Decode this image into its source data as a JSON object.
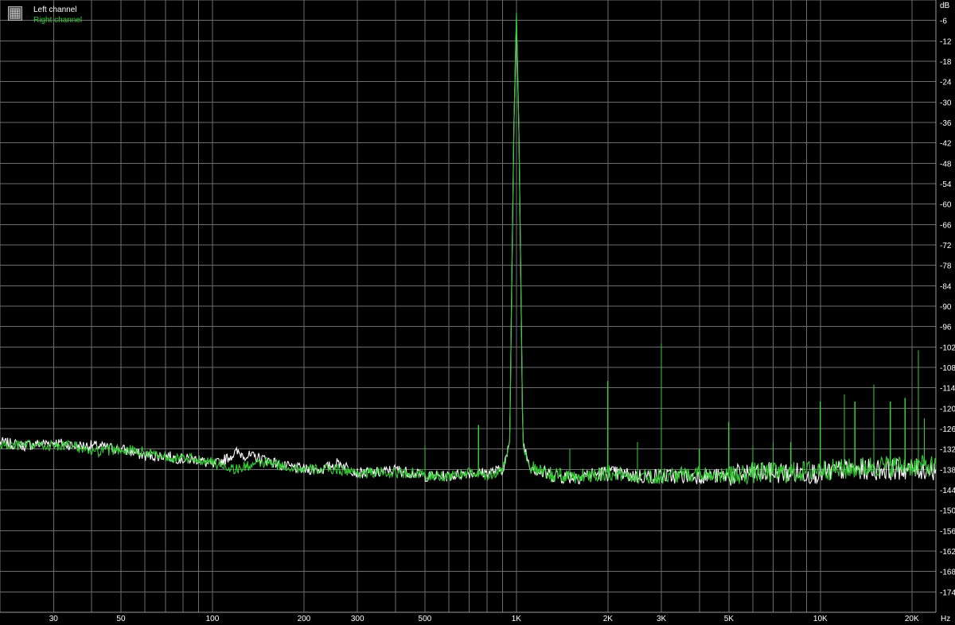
{
  "chart_data": {
    "type": "line",
    "title": "",
    "xlabel": "Hz",
    "ylabel": "dB",
    "x_scale": "log",
    "xlim": [
      20,
      24000
    ],
    "ylim": [
      -180,
      0
    ],
    "grid": true,
    "legend_placement": "top-left",
    "x_ticks": [
      {
        "value": 30,
        "label": "30"
      },
      {
        "value": 50,
        "label": "50"
      },
      {
        "value": 100,
        "label": "100"
      },
      {
        "value": 200,
        "label": "200"
      },
      {
        "value": 300,
        "label": "300"
      },
      {
        "value": 500,
        "label": "500"
      },
      {
        "value": 1000,
        "label": "1K"
      },
      {
        "value": 2000,
        "label": "2K"
      },
      {
        "value": 3000,
        "label": "3K"
      },
      {
        "value": 5000,
        "label": "5K"
      },
      {
        "value": 10000,
        "label": "10K"
      },
      {
        "value": 20000,
        "label": "20K"
      }
    ],
    "y_ticks": [
      -6,
      -12,
      -18,
      -24,
      -30,
      -36,
      -42,
      -48,
      -54,
      -60,
      -66,
      -72,
      -78,
      -84,
      -90,
      -96,
      -102,
      -108,
      -114,
      -120,
      -126,
      -132,
      -138,
      -144,
      -150,
      -156,
      -162,
      -168,
      -174
    ],
    "series": [
      {
        "name": "Left channel",
        "color": "#ffffff",
        "points": [
          [
            20,
            -130
          ],
          [
            24,
            -131
          ],
          [
            30,
            -130
          ],
          [
            35,
            -131
          ],
          [
            40,
            -131
          ],
          [
            50,
            -132
          ],
          [
            60,
            -134
          ],
          [
            70,
            -134
          ],
          [
            80,
            -135
          ],
          [
            90,
            -135
          ],
          [
            100,
            -137
          ],
          [
            110,
            -135
          ],
          [
            120,
            -133
          ],
          [
            130,
            -134
          ],
          [
            150,
            -135
          ],
          [
            170,
            -137
          ],
          [
            200,
            -138
          ],
          [
            230,
            -138
          ],
          [
            260,
            -136
          ],
          [
            300,
            -139
          ],
          [
            350,
            -139
          ],
          [
            400,
            -138
          ],
          [
            450,
            -139
          ],
          [
            500,
            -140
          ],
          [
            550,
            -140
          ],
          [
            600,
            -140
          ],
          [
            700,
            -139
          ],
          [
            800,
            -139
          ],
          [
            900,
            -138
          ],
          [
            950,
            -131
          ],
          [
            980,
            -40
          ],
          [
            1000,
            -5
          ],
          [
            1020,
            -40
          ],
          [
            1050,
            -130
          ],
          [
            1100,
            -136
          ],
          [
            1200,
            -139
          ],
          [
            1400,
            -140
          ],
          [
            1600,
            -140
          ],
          [
            2000,
            -139
          ],
          [
            2500,
            -140
          ],
          [
            3000,
            -140
          ],
          [
            4000,
            -140
          ],
          [
            5000,
            -140
          ],
          [
            6000,
            -139
          ],
          [
            8000,
            -139
          ],
          [
            10000,
            -139
          ],
          [
            12000,
            -138
          ],
          [
            15000,
            -138
          ],
          [
            18000,
            -138
          ],
          [
            20000,
            -138
          ],
          [
            24000,
            -138
          ]
        ]
      },
      {
        "name": "Right channel",
        "color": "#33cc33",
        "points": [
          [
            20,
            -131
          ],
          [
            24,
            -131
          ],
          [
            30,
            -131
          ],
          [
            35,
            -131
          ],
          [
            40,
            -133
          ],
          [
            50,
            -132
          ],
          [
            60,
            -133
          ],
          [
            70,
            -134
          ],
          [
            80,
            -135
          ],
          [
            90,
            -135
          ],
          [
            100,
            -136
          ],
          [
            110,
            -137
          ],
          [
            120,
            -138
          ],
          [
            130,
            -137
          ],
          [
            150,
            -136
          ],
          [
            170,
            -137
          ],
          [
            200,
            -138
          ],
          [
            230,
            -138
          ],
          [
            260,
            -138
          ],
          [
            300,
            -139
          ],
          [
            350,
            -139
          ],
          [
            400,
            -139
          ],
          [
            450,
            -139
          ],
          [
            500,
            -140
          ],
          [
            550,
            -140
          ],
          [
            600,
            -140
          ],
          [
            700,
            -139
          ],
          [
            800,
            -140
          ],
          [
            900,
            -138
          ],
          [
            950,
            -131
          ],
          [
            980,
            -40
          ],
          [
            1000,
            -3
          ],
          [
            1020,
            -40
          ],
          [
            1050,
            -130
          ],
          [
            1100,
            -137
          ],
          [
            1200,
            -139
          ],
          [
            1400,
            -140
          ],
          [
            1600,
            -140
          ],
          [
            2000,
            -139
          ],
          [
            2500,
            -140
          ],
          [
            3000,
            -140
          ],
          [
            4000,
            -139
          ],
          [
            5000,
            -140
          ],
          [
            6000,
            -139
          ],
          [
            8000,
            -139
          ],
          [
            10000,
            -138
          ],
          [
            12000,
            -138
          ],
          [
            15000,
            -137
          ],
          [
            18000,
            -137
          ],
          [
            20000,
            -137
          ],
          [
            24000,
            -137
          ]
        ],
        "spikes": [
          [
            500,
            -131
          ],
          [
            750,
            -125
          ],
          [
            1500,
            -132
          ],
          [
            2000,
            -112
          ],
          [
            2500,
            -130
          ],
          [
            3000,
            -101
          ],
          [
            4000,
            -132
          ],
          [
            5000,
            -124
          ],
          [
            6000,
            -131
          ],
          [
            7000,
            -130
          ],
          [
            8000,
            -130
          ],
          [
            10000,
            -118
          ],
          [
            12000,
            -116
          ],
          [
            13000,
            -118
          ],
          [
            15000,
            -113
          ],
          [
            17000,
            -118
          ],
          [
            19000,
            -117
          ],
          [
            21000,
            -103
          ],
          [
            22000,
            -123
          ]
        ]
      }
    ]
  }
}
